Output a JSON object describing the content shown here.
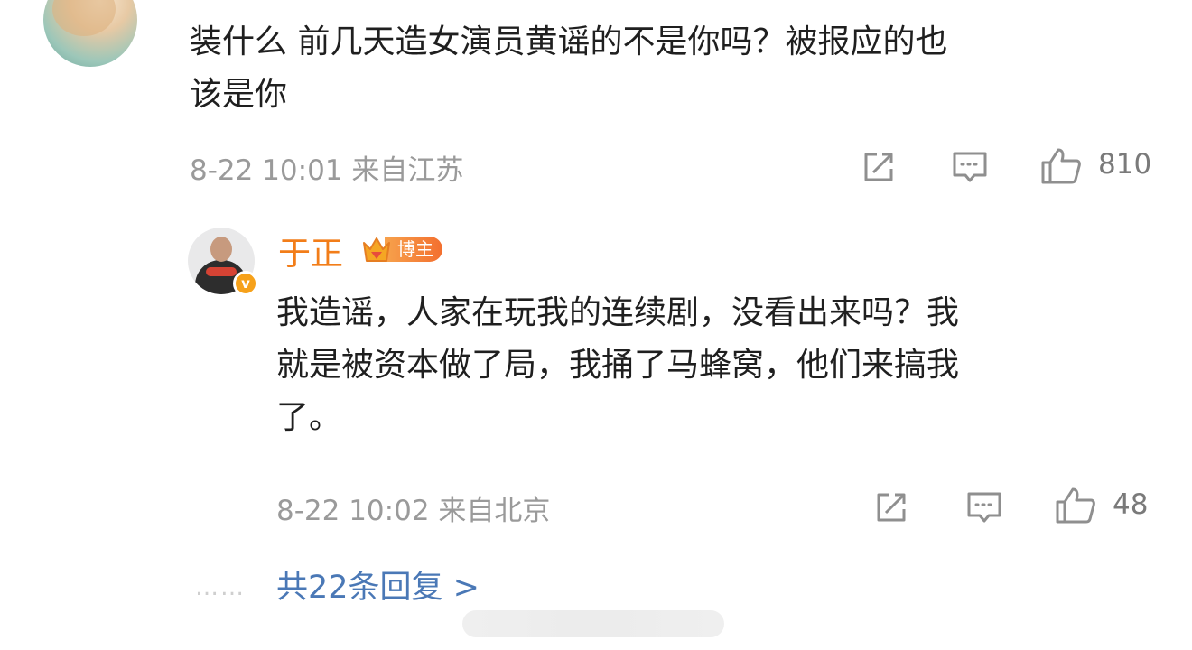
{
  "comment": {
    "text": "装什么 前几天造女演员黄谣的不是你吗？被报应的也\n该是你",
    "timestamp": "8-22 10:01",
    "location": "来自江苏",
    "like_count": "810"
  },
  "reply": {
    "username": "于正",
    "badge_label": "博主",
    "verified_mark": "v",
    "text": "我造谣，人家在玩我的连续剧，没看出来吗？我\n就是被资本做了局，我捅了马蜂窝，他们来搞我\n了。",
    "timestamp": "8-22 10:02",
    "location": "来自北京",
    "like_count": "48"
  },
  "footer": {
    "more_replies": "共22条回复 >",
    "dots": "……"
  },
  "colors": {
    "text": "#1f1f1f",
    "meta": "#9a9a9a",
    "link": "#4a78b6",
    "username": "#f27d19",
    "badge": "#f36f2f"
  }
}
